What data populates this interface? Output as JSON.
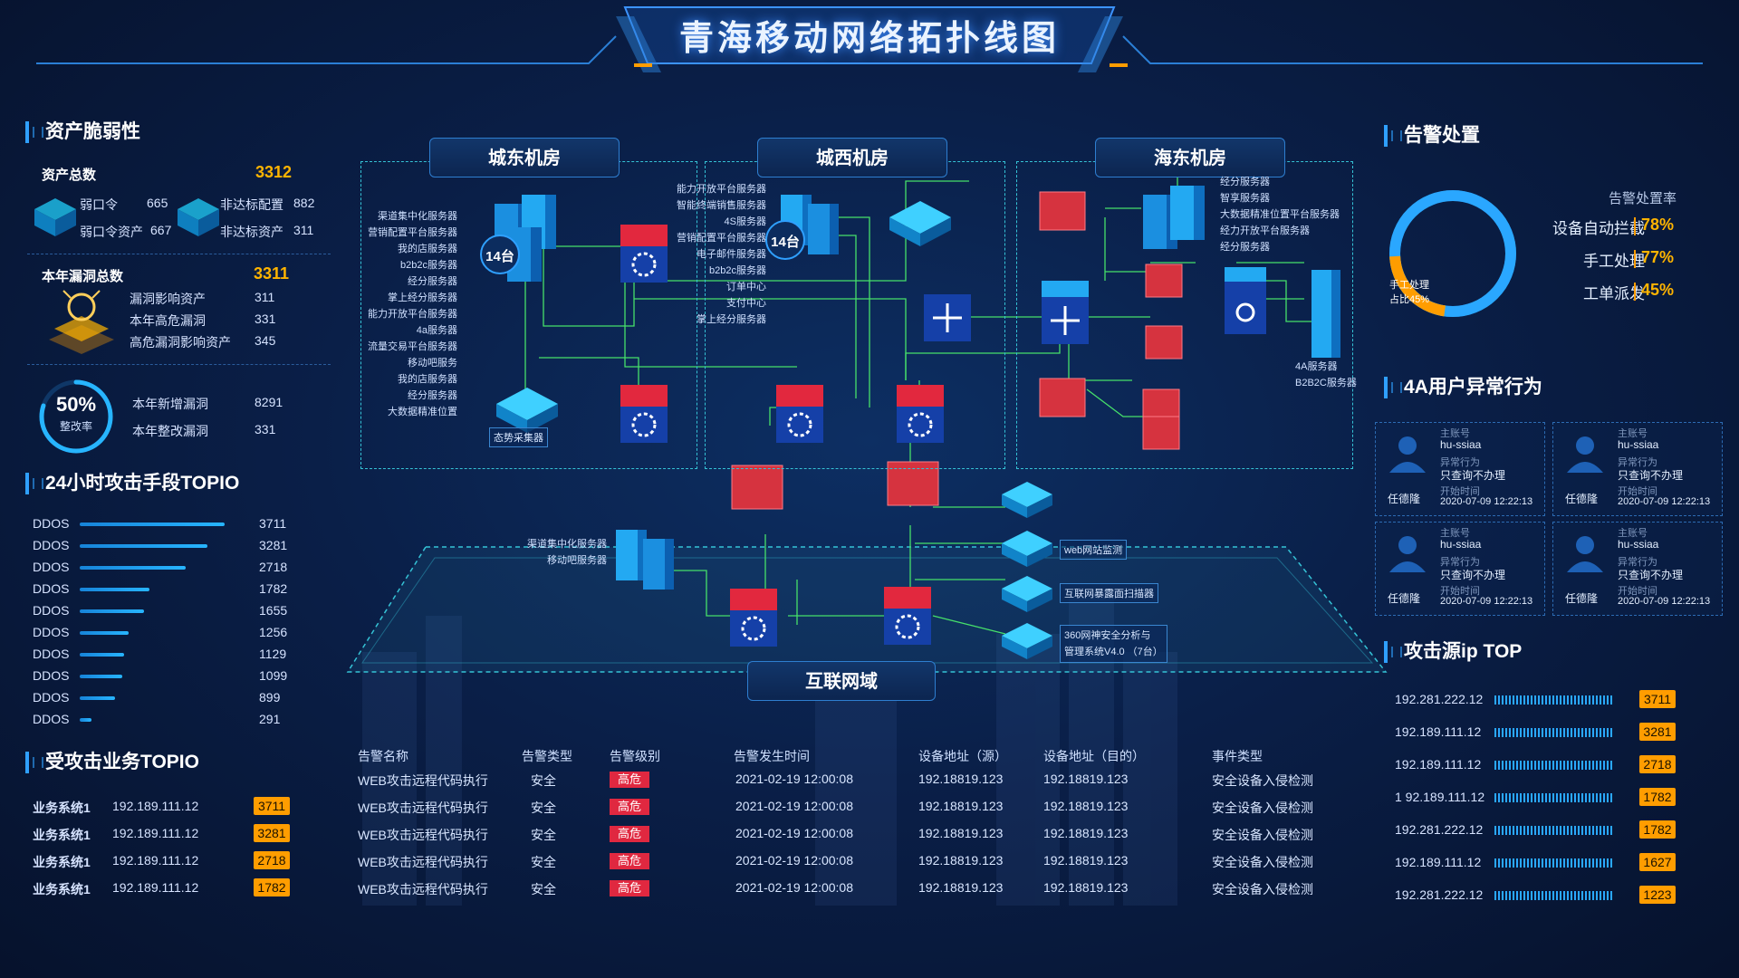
{
  "header": {
    "title": "青海移动网络拓扑线图"
  },
  "asset": {
    "section_title": "资产脆弱性",
    "total_label": "资产总数",
    "total_value": "3312",
    "weak_pwd_label": "弱口令",
    "weak_pwd_value": "665",
    "weak_pwd_asset_label": "弱口令资产",
    "weak_pwd_asset_value": "667",
    "noncompliant_cfg_label": "非达标配置",
    "noncompliant_cfg_value": "882",
    "noncompliant_asset_label": "非达标资产",
    "noncompliant_asset_value": "311",
    "vuln_total_label": "本年漏洞总数",
    "vuln_total_value": "3311",
    "vuln_items": [
      {
        "label": "漏洞影响资产",
        "value": "311"
      },
      {
        "label": "本年高危漏洞",
        "value": "331"
      },
      {
        "label": "高危漏洞影响资产",
        "value": "345"
      }
    ],
    "fix_rate_value": "50%",
    "fix_rate_label": "整改率",
    "fix_rate_fraction": 0.5,
    "new_vuln_label": "本年新增漏洞",
    "new_vuln_value": "8291",
    "fixed_vuln_label": "本年整改漏洞",
    "fixed_vuln_value": "331"
  },
  "attack_method": {
    "section_title": "24小时攻击手段TOPIO",
    "items": [
      {
        "label": "DDOS",
        "value": 3711
      },
      {
        "label": "DDOS",
        "value": 3281
      },
      {
        "label": "DDOS",
        "value": 2718
      },
      {
        "label": "DDOS",
        "value": 1782
      },
      {
        "label": "DDOS",
        "value": 1655
      },
      {
        "label": "DDOS",
        "value": 1256
      },
      {
        "label": "DDOS",
        "value": 1129
      },
      {
        "label": "DDOS",
        "value": 1099
      },
      {
        "label": "DDOS",
        "value": 899
      },
      {
        "label": "DDOS",
        "value": 291
      }
    ]
  },
  "attacked_business": {
    "section_title": "受攻击业务TOPIO",
    "rows": [
      {
        "name": "业务系统1",
        "ip": "192.189.111.12",
        "count": "3711"
      },
      {
        "name": "业务系统1",
        "ip": "192.189.111.12",
        "count": "3281"
      },
      {
        "name": "业务系统1",
        "ip": "192.189.111.12",
        "count": "2718"
      },
      {
        "name": "业务系统1",
        "ip": "192.189.111.12",
        "count": "1782"
      }
    ]
  },
  "topology": {
    "rooms": {
      "east": "城东机房",
      "west": "城西机房",
      "haidong": "海东机房",
      "internet": "互联网域"
    },
    "east_labels": [
      "渠道集中化服务器",
      "营销配置平台服务器",
      "我的店服务器",
      "b2b2c服务器",
      "经分服务器",
      "掌上经分服务器",
      "能力开放平台服务器",
      "4a服务器",
      "流量交易平台服务器",
      "移动吧服务",
      "我的店服务器",
      "经分服务器",
      "大数据精准位置"
    ],
    "east_count": "14台",
    "collector_label": "态势采集器",
    "west_labels": [
      "能力开放平台服务器",
      "智能终端销售服务器",
      "4S服务器",
      "营销配置平台服务器",
      "电子邮件服务器",
      "b2b2c服务器",
      "订单中心",
      "支付中心",
      "掌上经分服务器"
    ],
    "west_count": "14台",
    "haidong_labels": [
      "经分服务器",
      "智享服务器",
      "大数据精准位置平台服务器",
      "经力开放平台服务器",
      "经分服务器"
    ],
    "haidong_right_labels": [
      "4A服务器",
      "B2B2C服务器"
    ],
    "internet_labels": [
      "渠道集中化服务器",
      "移动吧服务器"
    ],
    "right_devices": [
      "web网站监测",
      "互联网暴露面扫描器",
      "360网神安全分析与",
      "管理系统V4.0 （7台）"
    ]
  },
  "alarm_table": {
    "headers": [
      "告警名称",
      "告警类型",
      "告警级别",
      "告警发生时间",
      "设备地址（源）",
      "设备地址（目的）",
      "事件类型"
    ],
    "rows": [
      {
        "name": "WEB攻击远程代码执行",
        "type": "安全",
        "level": "高危",
        "time": "2021-02-19   12:00:08",
        "src": "192.18819.123",
        "dst": "192.18819.123",
        "event": "安全设备入侵检测"
      },
      {
        "name": "WEB攻击远程代码执行",
        "type": "安全",
        "level": "高危",
        "time": "2021-02-19   12:00:08",
        "src": "192.18819.123",
        "dst": "192.18819.123",
        "event": "安全设备入侵检测"
      },
      {
        "name": "WEB攻击远程代码执行",
        "type": "安全",
        "level": "高危",
        "time": "2021-02-19   12:00:08",
        "src": "192.18819.123",
        "dst": "192.18819.123",
        "event": "安全设备入侵检测"
      },
      {
        "name": "WEB攻击远程代码执行",
        "type": "安全",
        "level": "高危",
        "time": "2021-02-19   12:00:08",
        "src": "192.18819.123",
        "dst": "192.18819.123",
        "event": "安全设备入侵检测"
      },
      {
        "name": "WEB攻击远程代码执行",
        "type": "安全",
        "level": "高危",
        "time": "2021-02-19   12:00:08",
        "src": "192.18819.123",
        "dst": "192.18819.123",
        "event": "安全设备入侵检测"
      }
    ]
  },
  "alarm_handling": {
    "section_title": "告警处置",
    "rate_title": "告警处置率",
    "ring_label_1": "手工处理",
    "ring_label_2": "占比45%",
    "ring_fraction": 0.45,
    "items": [
      {
        "label": "设备自动拦截",
        "value": "78%"
      },
      {
        "label": "手工处理",
        "value": "77%"
      },
      {
        "label": "工单派发",
        "value": "45%"
      }
    ]
  },
  "user_behavior": {
    "section_title": "4A用户异常行为",
    "cards": [
      {
        "acct_k": "主账号",
        "acct": "hu-ssiaa",
        "act_k": "异常行为",
        "act": "只查询不办理",
        "time_k": "开始时间",
        "time": "2020-07-09  12:22:13",
        "name": "任德隆"
      },
      {
        "acct_k": "主账号",
        "acct": "hu-ssiaa",
        "act_k": "异常行为",
        "act": "只查询不办理",
        "time_k": "开始时间",
        "time": "2020-07-09  12:22:13",
        "name": "任德隆"
      },
      {
        "acct_k": "主账号",
        "acct": "hu-ssiaa",
        "act_k": "异常行为",
        "act": "只查询不办理",
        "time_k": "开始时间",
        "time": "2020-07-09  12:22:13",
        "name": "任德隆"
      },
      {
        "acct_k": "主账号",
        "acct": "hu-ssiaa",
        "act_k": "异常行为",
        "act": "只查询不办理",
        "time_k": "开始时间",
        "time": "2020-07-09  12:22:13",
        "name": "任德隆"
      }
    ]
  },
  "attack_ip": {
    "section_title": "攻击源ip  TOP",
    "rows": [
      {
        "ip": "192.281.222.12",
        "count": "3711",
        "fill": 1.0
      },
      {
        "ip": "192.189.111.12",
        "count": "3281",
        "fill": 1.0
      },
      {
        "ip": "192.189.111.12",
        "count": "2718",
        "fill": 1.0
      },
      {
        "ip": "1 92.189.111.12",
        "count": "1782",
        "fill": 1.0
      },
      {
        "ip": "192.281.222.12",
        "count": "1782",
        "fill": 1.0
      },
      {
        "ip": "192.189.111.12",
        "count": "1627",
        "fill": 1.0
      },
      {
        "ip": "192.281.222.12",
        "count": "1223",
        "fill": 1.0
      }
    ]
  }
}
